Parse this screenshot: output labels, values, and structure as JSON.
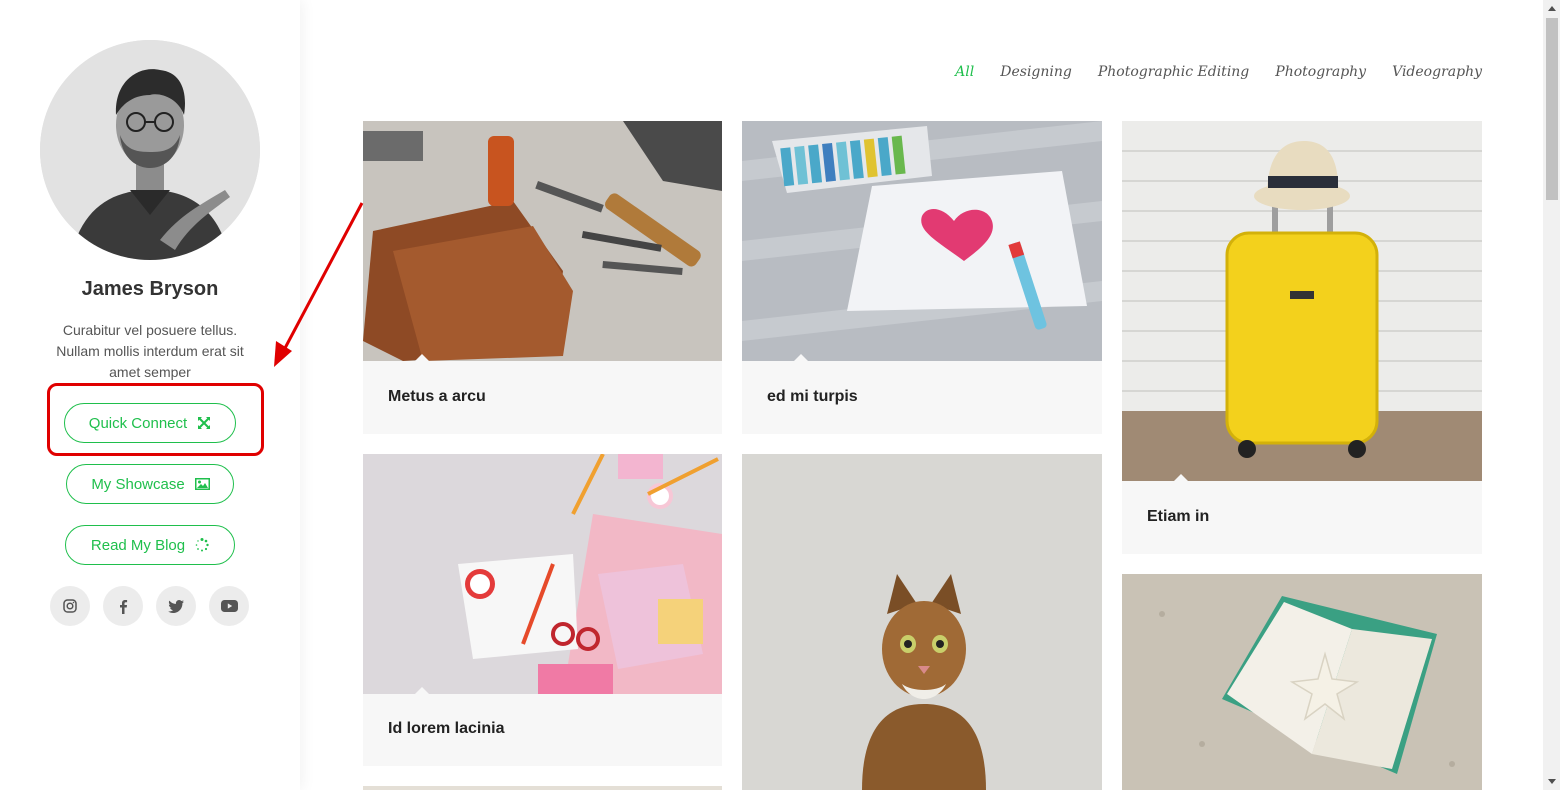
{
  "profile": {
    "name": "James Bryson",
    "bio": "Curabitur vel posuere tellus. Nullam mollis interdum erat sit amet semper"
  },
  "buttons": {
    "quick_connect": "Quick Connect",
    "my_showcase": "My Showcase",
    "read_blog": "Read My Blog"
  },
  "socials": [
    "instagram-icon",
    "facebook-icon",
    "twitter-icon",
    "youtube-icon"
  ],
  "filters": [
    "All",
    "Designing",
    "Photographic Editing",
    "Photography",
    "Videography"
  ],
  "active_filter": "All",
  "cards": [
    {
      "caption": "Metus a arcu"
    },
    {
      "caption": "ed mi turpis"
    },
    {
      "caption": "Etiam in"
    },
    {
      "caption": "Id lorem lacinia"
    },
    {
      "caption": ""
    },
    {
      "caption": ""
    }
  ],
  "colors": {
    "accent": "#1fbf4c",
    "highlight": "#e00000",
    "card_bg": "#f7f7f7"
  }
}
